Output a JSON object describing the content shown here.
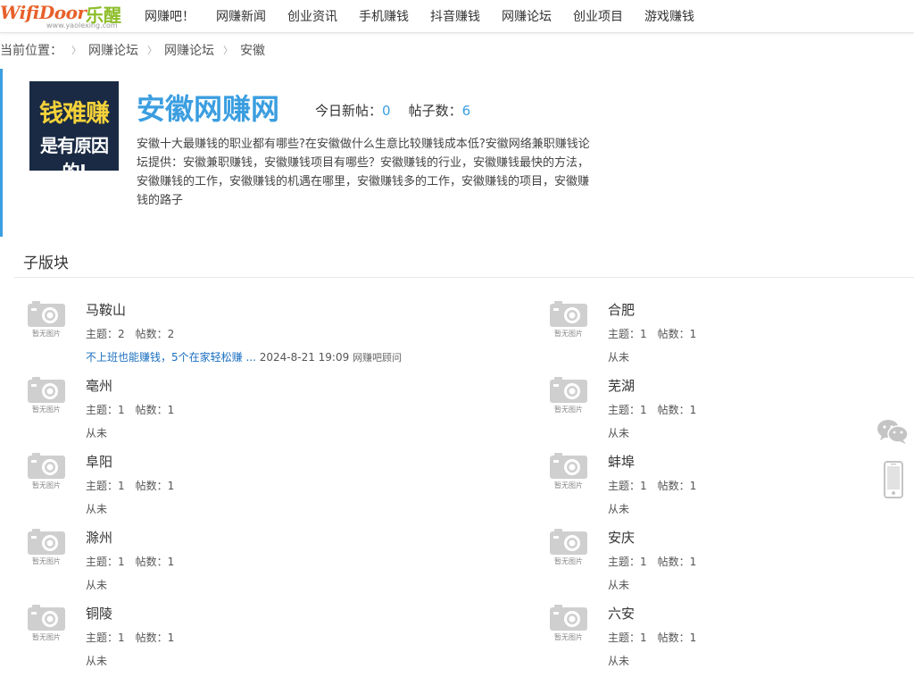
{
  "logo": {
    "brand": "WifiDoor",
    "brand_cn": "乐醒",
    "domain": "www.yaolexing.com"
  },
  "nav": [
    "网赚吧！",
    "网赚新闻",
    "创业资讯",
    "手机赚钱",
    "抖音赚钱",
    "网赚论坛",
    "创业项目",
    "游戏赚钱"
  ],
  "breadcrumb": {
    "label": "当前位置：",
    "items": [
      "网赚论坛",
      "网赚论坛",
      "安徽"
    ]
  },
  "forum": {
    "logo_line1": "钱难赚",
    "logo_line2": "是有原因的!",
    "title": "安徽网赚网",
    "today_label": "今日新帖：",
    "today_value": "0",
    "posts_label": "帖子数：",
    "posts_value": "6",
    "description": "安徽十大最赚钱的职业都有哪些?在安徽做什么生意比较赚钱成本低?安徽网络兼职赚钱论坛提供：安徽兼职赚钱，安徽赚钱项目有哪些？安徽赚钱的行业，安徽赚钱最快的方法，安徽赚钱的工作，安徽赚钱的机遇在哪里，安徽赚钱多的工作，安徽赚钱的项目，安徽赚钱的路子"
  },
  "subforums": {
    "heading": "子版块",
    "thumb_text": "暂无图片",
    "items": [
      {
        "name": "马鞍山",
        "meta": "主题：2　帖数：2",
        "last_link": "不上班也能赚钱，5个在家轻松赚 ...",
        "last_time": "2024-8-21 19:09",
        "last_user": "网赚吧顾问"
      },
      {
        "name": "合肥",
        "meta": "主题：1　帖数：1",
        "last": "从未"
      },
      {
        "name": "亳州",
        "meta": "主题：1　帖数：1",
        "last": "从未"
      },
      {
        "name": "芜湖",
        "meta": "主题：1　帖数：1",
        "last": "从未"
      },
      {
        "name": "阜阳",
        "meta": "主题：1　帖数：1",
        "last": "从未"
      },
      {
        "name": "蚌埠",
        "meta": "主题：1　帖数：1",
        "last": "从未"
      },
      {
        "name": "滁州",
        "meta": "主题：1　帖数：1",
        "last": "从未"
      },
      {
        "name": "安庆",
        "meta": "主题：1　帖数：1",
        "last": "从未"
      },
      {
        "name": "铜陵",
        "meta": "主题：1　帖数：1",
        "last": "从未"
      },
      {
        "name": "六安",
        "meta": "主题：1　帖数：1",
        "last": "从未"
      }
    ]
  },
  "float_icons": [
    "wechat-icon",
    "mobile-icon"
  ],
  "colors": {
    "accent": "#3b9ee0",
    "link": "#1a6ec0",
    "logo_bg": "#1a2a44",
    "logo_yellow": "#f5d23a"
  }
}
